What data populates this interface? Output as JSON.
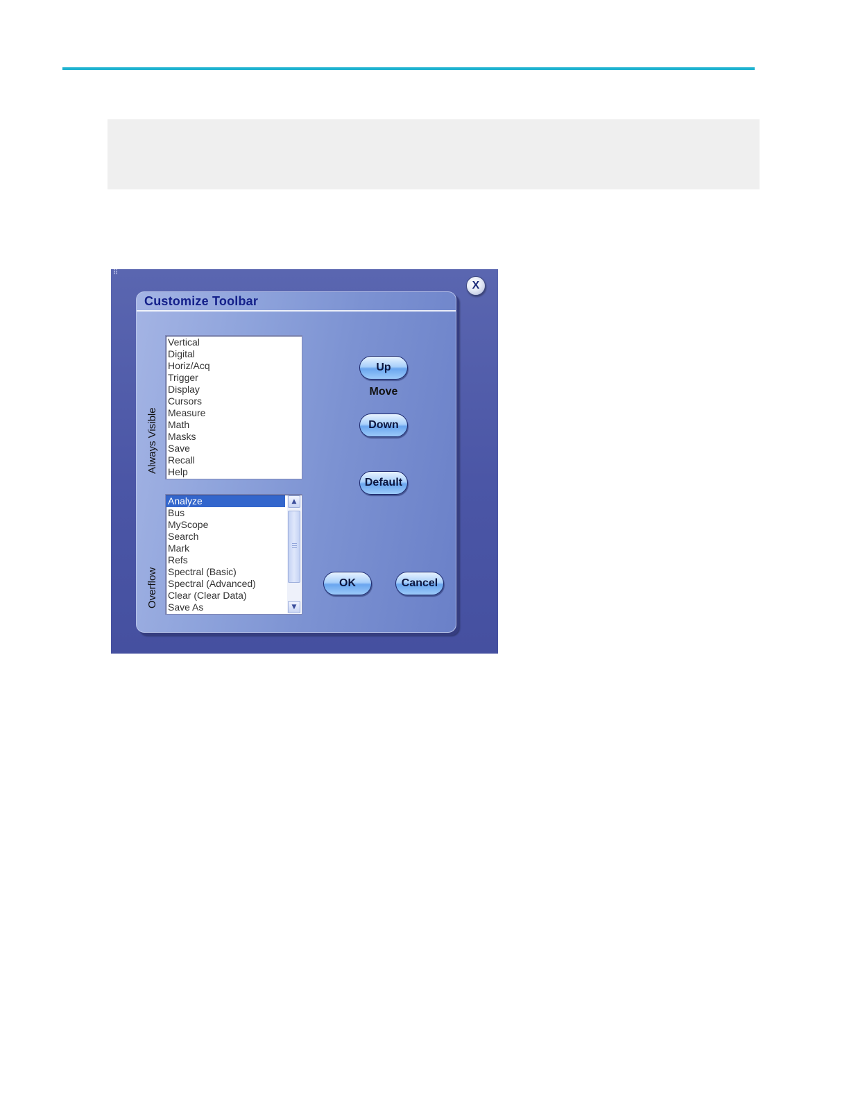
{
  "dialog": {
    "title": "Customize Toolbar",
    "close_label": "X",
    "always_visible": {
      "label": "Always Visible",
      "items": [
        "Vertical",
        "Digital",
        "Horiz/Acq",
        "Trigger",
        "Display",
        "Cursors",
        "Measure",
        "Math",
        "Masks",
        "Save",
        "Recall",
        "Help"
      ]
    },
    "overflow": {
      "label": "Overflow",
      "selected_item": "Analyze",
      "items": [
        "Analyze",
        "Bus",
        "MyScope",
        "Search",
        "Mark",
        "Refs",
        "Spectral (Basic)",
        "Spectral (Advanced)",
        "Clear (Clear Data)",
        "Save As"
      ]
    },
    "buttons": {
      "up": "Up",
      "move_label": "Move",
      "down": "Down",
      "default": "Default",
      "ok": "OK",
      "cancel": "Cancel"
    }
  },
  "colors": {
    "accent_rule": "#1fb3d0",
    "title_text": "#14208a",
    "selection": "#3366cc"
  }
}
